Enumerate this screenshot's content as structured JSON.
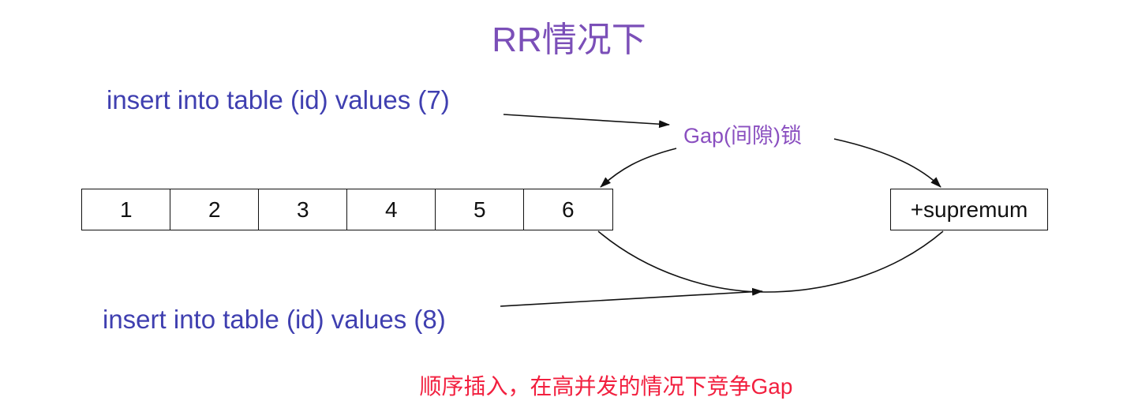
{
  "title": "RR情况下",
  "statements": {
    "insert7": "insert into table (id) values (7)",
    "insert8": "insert into table (id) values (8)"
  },
  "gap_label": "Gap(间隙)锁",
  "records": [
    "1",
    "2",
    "3",
    "4",
    "5",
    "6"
  ],
  "supremum": "+supremum",
  "note": "顺序插入，在高并发的情况下竞争Gap",
  "colors": {
    "title": "#7b4fb8",
    "statement": "#3f3fb0",
    "gap_label": "#8a4fc0",
    "note": "#f2203f",
    "line": "#111111"
  }
}
